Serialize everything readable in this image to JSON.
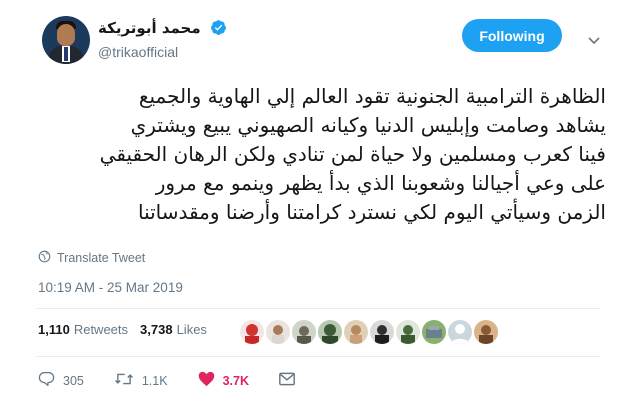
{
  "author": {
    "display_name": "محمد أبوتريكة",
    "handle": "@trikaofficial"
  },
  "follow_button": {
    "label": "Following"
  },
  "tweet": {
    "lines": [
      "الظاهرة الترامبية الجنونية تقود العالم إلي الهاوية والجميع",
      "يشاهد وصامت وإبليس الدنيا وكيانه الصهيوني يبيع ويشتري",
      "فينا كعرب ومسلمين ولا حياة لمن تنادي ولكن الرهان الحقيقي",
      "على وعي أجيالنا وشعوبنا الذي بدأ يظهر وينمو مع مرور",
      "الزمن وسيأتي اليوم لكي نسترد كرامتنا وأرضنا ومقدساتنا"
    ],
    "translate_label": "Translate Tweet",
    "timestamp": "10:19 AM - 25 Mar 2019"
  },
  "stats": {
    "retweets_count": "1,110",
    "retweets_label": "Retweets",
    "likes_count": "3,738",
    "likes_label": "Likes"
  },
  "actions": {
    "replies": "305",
    "retweets": "1.1K",
    "likes": "3.7K"
  },
  "colors": {
    "accent": "#1da1f2",
    "like": "#e0245e",
    "muted": "#657786"
  }
}
